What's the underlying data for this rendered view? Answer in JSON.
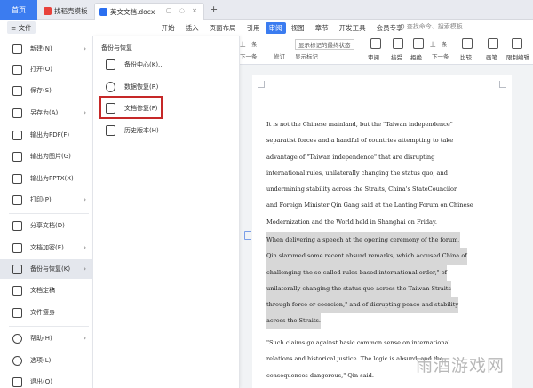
{
  "titlebar": {
    "home_tab": "首页",
    "tab1": "找稻壳模板",
    "tab2": "英文文档.docx",
    "tab2_controls": "▢ ◌ ×",
    "new_tab": "+"
  },
  "menubar": {
    "file": "≡ 文件",
    "items": [
      "开始",
      "插入",
      "页面布局",
      "引用",
      "审阅",
      "视图",
      "章节",
      "开发工具",
      "会员专享"
    ],
    "active_item": "审阅",
    "search": "Q 查找命令、搜索模板"
  },
  "toolbar": {
    "prev_top": "上一条",
    "next_top": "下一条",
    "markup_select": "显示标记的最终状态",
    "show_markup": "显示标记",
    "revise": "修订",
    "review": "审阅",
    "accept": "接受",
    "reject": "拒绝",
    "prev": "上一条",
    "next": "下一条",
    "compare": "比较",
    "restrict": "限制编辑",
    "compare_side": "画笔"
  },
  "file_menu": {
    "items": [
      {
        "label": "新建(N)",
        "arrow": "›"
      },
      {
        "label": "打开(O)",
        "arrow": ""
      },
      {
        "label": "保存(S)",
        "arrow": ""
      },
      {
        "label": "另存为(A)",
        "arrow": "›"
      },
      {
        "label": "输出为PDF(F)",
        "arrow": ""
      },
      {
        "label": "输出为图片(G)",
        "arrow": ""
      },
      {
        "label": "输出为PPTX(X)",
        "arrow": ""
      },
      {
        "label": "打印(P)",
        "arrow": "›"
      },
      {
        "label": "分享文档(D)",
        "arrow": ""
      },
      {
        "label": "文档加密(E)",
        "arrow": "›"
      },
      {
        "label": "备份与恢复(K)",
        "arrow": "›"
      },
      {
        "label": "文档定稿",
        "arrow": ""
      },
      {
        "label": "文件瘦身",
        "arrow": ""
      },
      {
        "label": "帮助(H)",
        "arrow": "›"
      },
      {
        "label": "选项(L)",
        "arrow": ""
      },
      {
        "label": "退出(Q)",
        "arrow": ""
      }
    ]
  },
  "submenu": {
    "title": "备份与恢复",
    "items": [
      {
        "label": "备份中心(K)..."
      },
      {
        "label": "数据恢复(R)"
      },
      {
        "label": "文档修复(F)"
      },
      {
        "label": "历史版本(H)"
      }
    ]
  },
  "document": {
    "paragraph1": [
      "It is not the Chinese mainland, but the \"Taiwan independence\"",
      "separatist forces and a handful of countries attempting to take",
      "advantage  of  \"Taiwan  independence\"  that  are  disrupting",
      "international rules, unilaterally changing the status quo, and",
      "undermining stability across the Straits, China's StateCouncilor",
      "and Foreign Minister Qin Gang said at the Lanting Forum on Chinese",
      "Modernization and the World held in Shanghai on Friday."
    ],
    "paragraph2": [
      "When delivering a speech at the opening ceremony of the forum,",
      "Qin slammed some recent absurd remarks, which accused China of",
      "challenging the so-called rules-based international order,\" of",
      "unilaterally changing the status quo across the Taiwan Straits",
      "through force or coercion,\" and of disrupting peace and stability",
      "across the Straits."
    ],
    "paragraph3": [
      "\"Such claims go against basic common sense on international",
      "relations and historical justice. The logic is absurd, and the",
      "consequences dangerous,\" Qin said."
    ]
  },
  "watermark": "雨酒游戏网"
}
